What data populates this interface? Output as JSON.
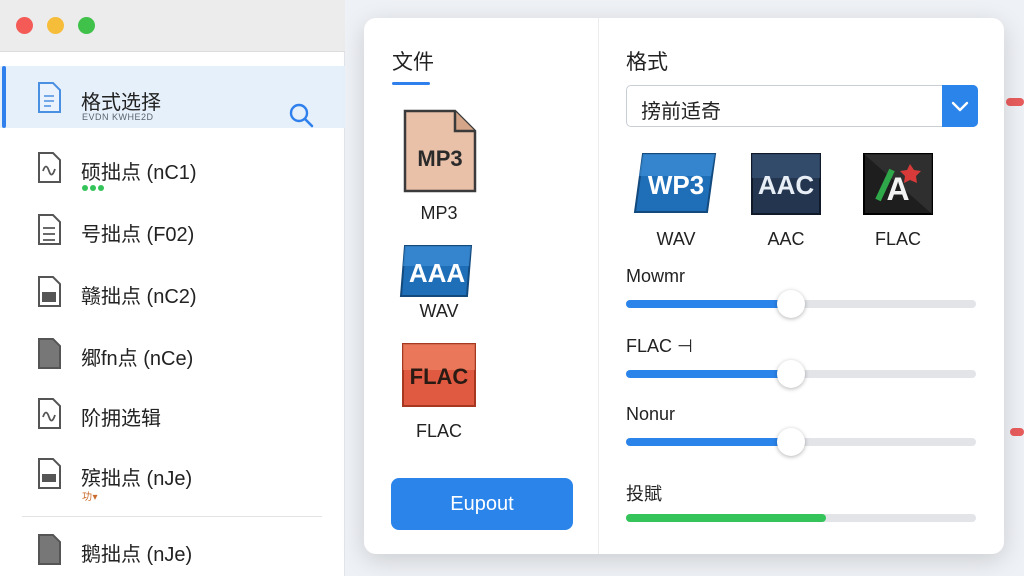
{
  "sidebar": {
    "items": [
      {
        "label": "格式选择",
        "sub": "EVDN KWHE2D",
        "active": true
      },
      {
        "label": "硕拙点 (nC1)"
      },
      {
        "label": "号拙点 (F02)"
      },
      {
        "label": "赣拙点 (nC2)"
      },
      {
        "label": "郷fn点 (nCe)"
      },
      {
        "label": "阶拥选辑"
      },
      {
        "label": "殡拙点 (nJe)",
        "sub": "功▾"
      },
      {
        "label": "鹅拙点 (nJe)"
      }
    ]
  },
  "dialog": {
    "tab_title": "文件",
    "files": [
      {
        "label": "MP3",
        "icon_text": "MP3",
        "icon": "mp3-file-icon"
      },
      {
        "label": "WAV",
        "icon_text": "AAA",
        "icon": "wav-file-icon"
      },
      {
        "label": "FLAC",
        "icon_text": "FLAC",
        "icon": "flac-file-icon"
      }
    ],
    "export_label": "Eupout",
    "format_title": "格式",
    "format_select_value": "搒前适奇",
    "formats": [
      {
        "label": "WAV",
        "icon_text": "WP3",
        "icon": "wav-format-icon"
      },
      {
        "label": "AAC",
        "icon_text": "AAC",
        "icon": "aac-format-icon"
      },
      {
        "label": "FLAC",
        "icon_text": "A",
        "icon": "flac-format-icon"
      }
    ],
    "sliders": [
      {
        "label": "Mowmr",
        "value": 0.47
      },
      {
        "label": "FLAC ⊣",
        "value": 0.47
      },
      {
        "label": "Nonur",
        "value": 0.47
      },
      {
        "label": "投賦",
        "value": 0.57
      }
    ]
  },
  "colors": {
    "accent": "#2b84ea",
    "progress_green": "#34c45a"
  }
}
